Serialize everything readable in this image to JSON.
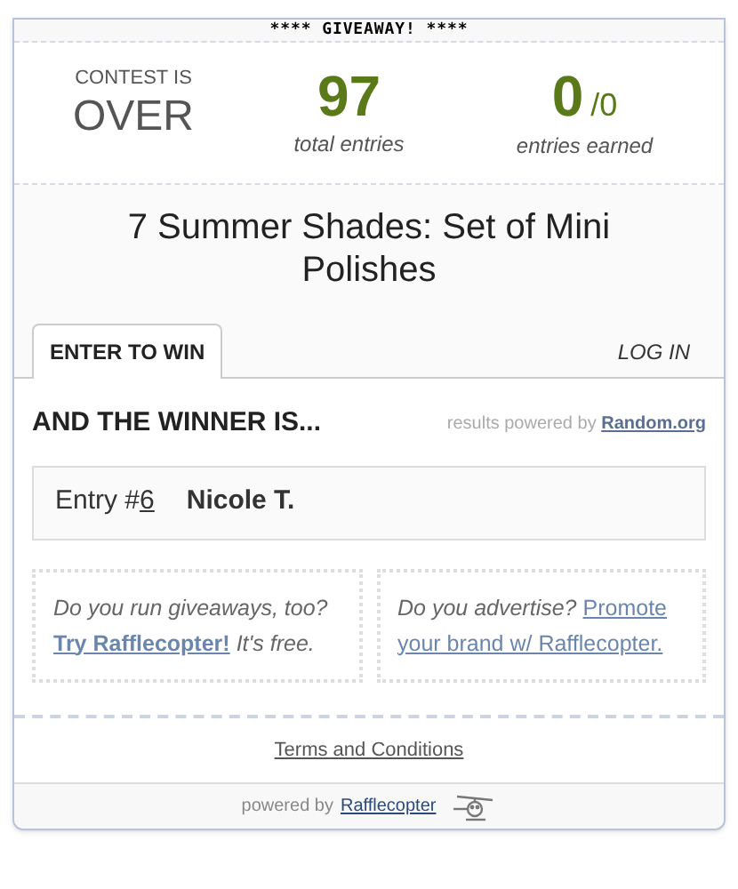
{
  "banner": "**** GIVEAWAY! ****",
  "status": {
    "label": "CONTEST IS",
    "value": "OVER"
  },
  "stats": [
    {
      "value": "97",
      "label": "total entries"
    },
    {
      "value": "0",
      "suffix": "/0",
      "label": "entries earned"
    }
  ],
  "title": "7 Summer Shades: Set of Mini Polishes",
  "tabs": [
    {
      "label": "ENTER TO WIN",
      "selected": true
    },
    {
      "label": "LOG IN",
      "selected": false
    }
  ],
  "winner": {
    "heading": "AND THE WINNER IS...",
    "credit": "results powered by",
    "credit_link": "Random.org",
    "entry_label": "Entry #",
    "entry_number": "6",
    "name": "Nicole T."
  },
  "promos": [
    {
      "question": "Do you run giveaways, too?",
      "link_lines": [
        "Try Rafflecopter!"
      ],
      "tail": "It's free."
    },
    {
      "question": "Do you advertise?",
      "link_lines": [
        "Promote",
        "your brand w/ Rafflecopter."
      ]
    }
  ],
  "terms": "Terms and Conditions",
  "footer": {
    "text": "powered by",
    "link": "Rafflecopter"
  }
}
